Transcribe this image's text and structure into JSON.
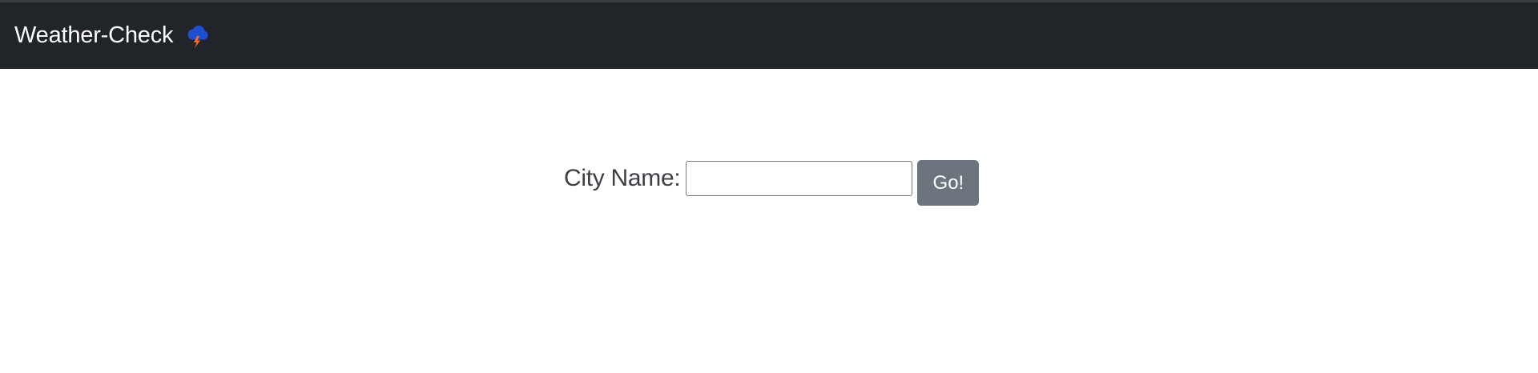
{
  "navbar": {
    "brand": "Weather-Check",
    "brand_icon": "thunder-cloud-icon"
  },
  "search": {
    "label": "City Name:",
    "input_value": "",
    "input_placeholder": "",
    "button_label": "Go!"
  },
  "colors": {
    "navbar_bg": "#212529",
    "button_bg": "#6c757d",
    "cloud": "#1f4fd1",
    "bolt": "#ff6a1f"
  }
}
